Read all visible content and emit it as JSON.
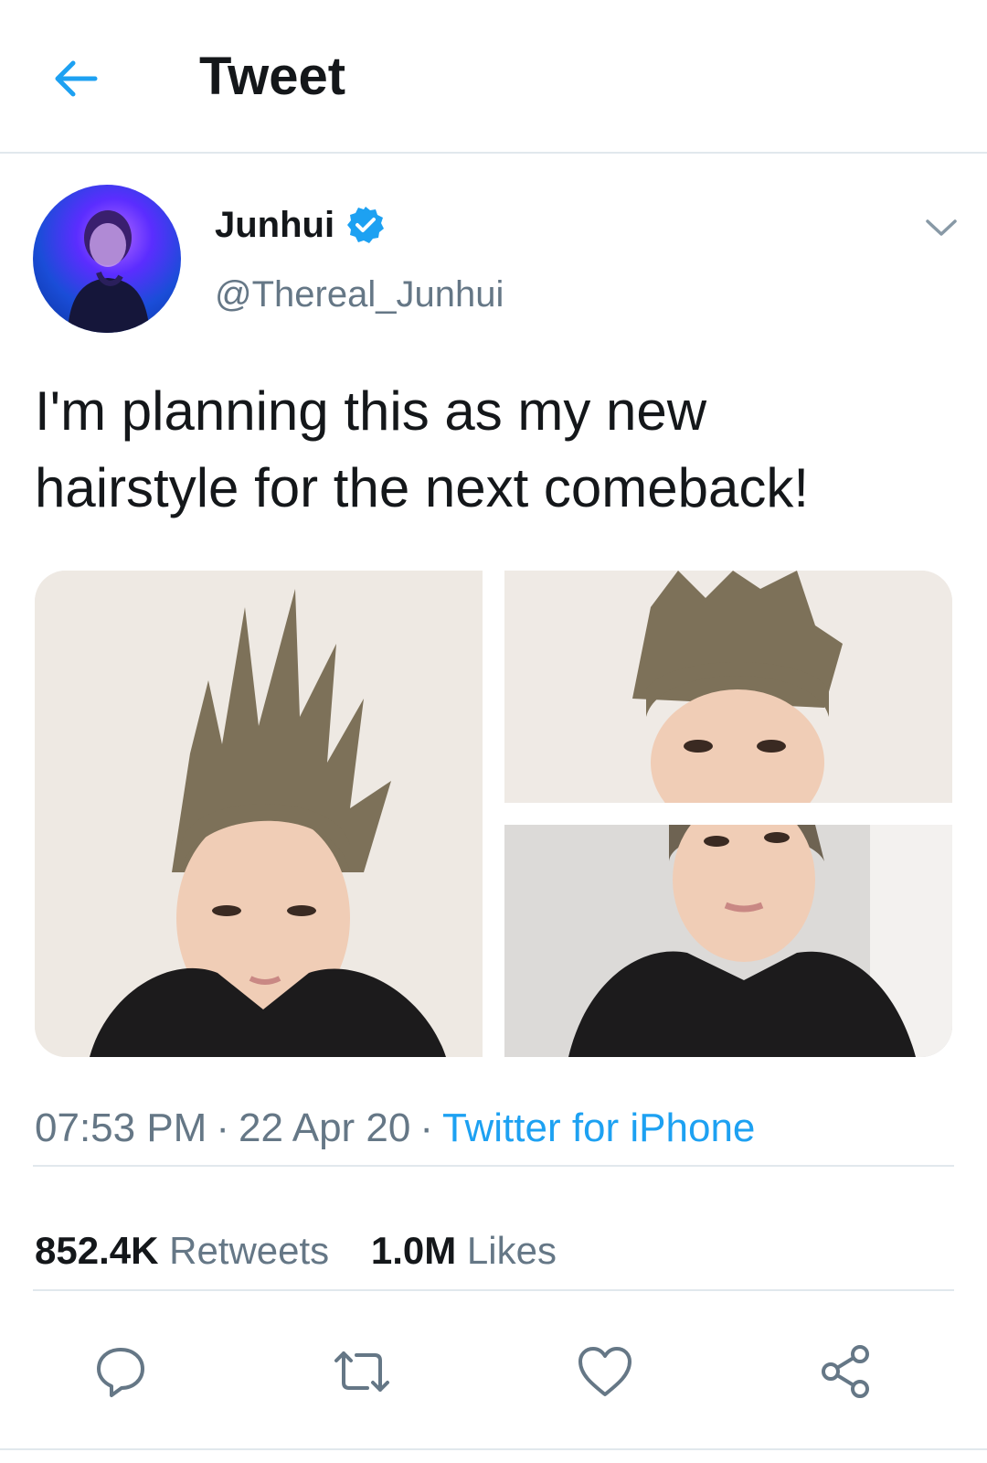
{
  "header": {
    "title": "Tweet",
    "back_icon": "arrow-left-icon"
  },
  "author": {
    "name": "Junhui",
    "handle": "@Thereal_Junhui",
    "verified": true,
    "avatar_icon": "profile-photo"
  },
  "tweet": {
    "text_line_1": "I'm planning this as my new",
    "text_line_2": "hairstyle for the next comeback!",
    "photos": [
      {
        "subject": "selfie with spiky hair, front"
      },
      {
        "subject": "close-up of spiky hair and eyes"
      },
      {
        "subject": "selfie in black hoodie"
      }
    ]
  },
  "meta": {
    "time": "07:53 PM",
    "separator": "·",
    "date": "22 Apr 20",
    "source": "Twitter for iPhone"
  },
  "stats": {
    "retweets_count": "852.4K",
    "retweets_label": "Retweets",
    "likes_count": "1.0M",
    "likes_label": "Likes"
  },
  "actions": {
    "reply_icon": "reply-icon",
    "retweet_icon": "retweet-icon",
    "like_icon": "heart-icon",
    "share_icon": "share-icon"
  },
  "colors": {
    "accent": "#1da1f2",
    "verified": "#1da1f2",
    "muted_text": "#657786",
    "divider": "#e1e8ed",
    "text": "#14171a"
  }
}
